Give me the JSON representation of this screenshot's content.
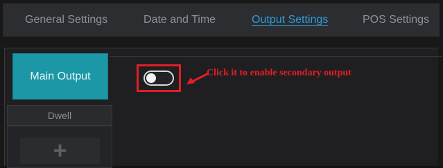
{
  "tabs": [
    {
      "label": "General Settings",
      "active": false
    },
    {
      "label": "Date and Time",
      "active": false
    },
    {
      "label": "Output Settings",
      "active": true
    },
    {
      "label": "POS Settings",
      "active": false
    }
  ],
  "main_output": {
    "label": "Main Output"
  },
  "secondary_output_toggle": {
    "enabled": false
  },
  "annotation": {
    "text": "Click it to enable secondary output",
    "color": "#e01f26"
  },
  "dwell": {
    "label": "Dwell"
  },
  "add_button": {
    "icon": "plus-icon",
    "glyph": "+"
  },
  "colors": {
    "accent": "#2f9bd8",
    "main_output_bg": "#1b97a6",
    "highlight": "#e01f26"
  }
}
